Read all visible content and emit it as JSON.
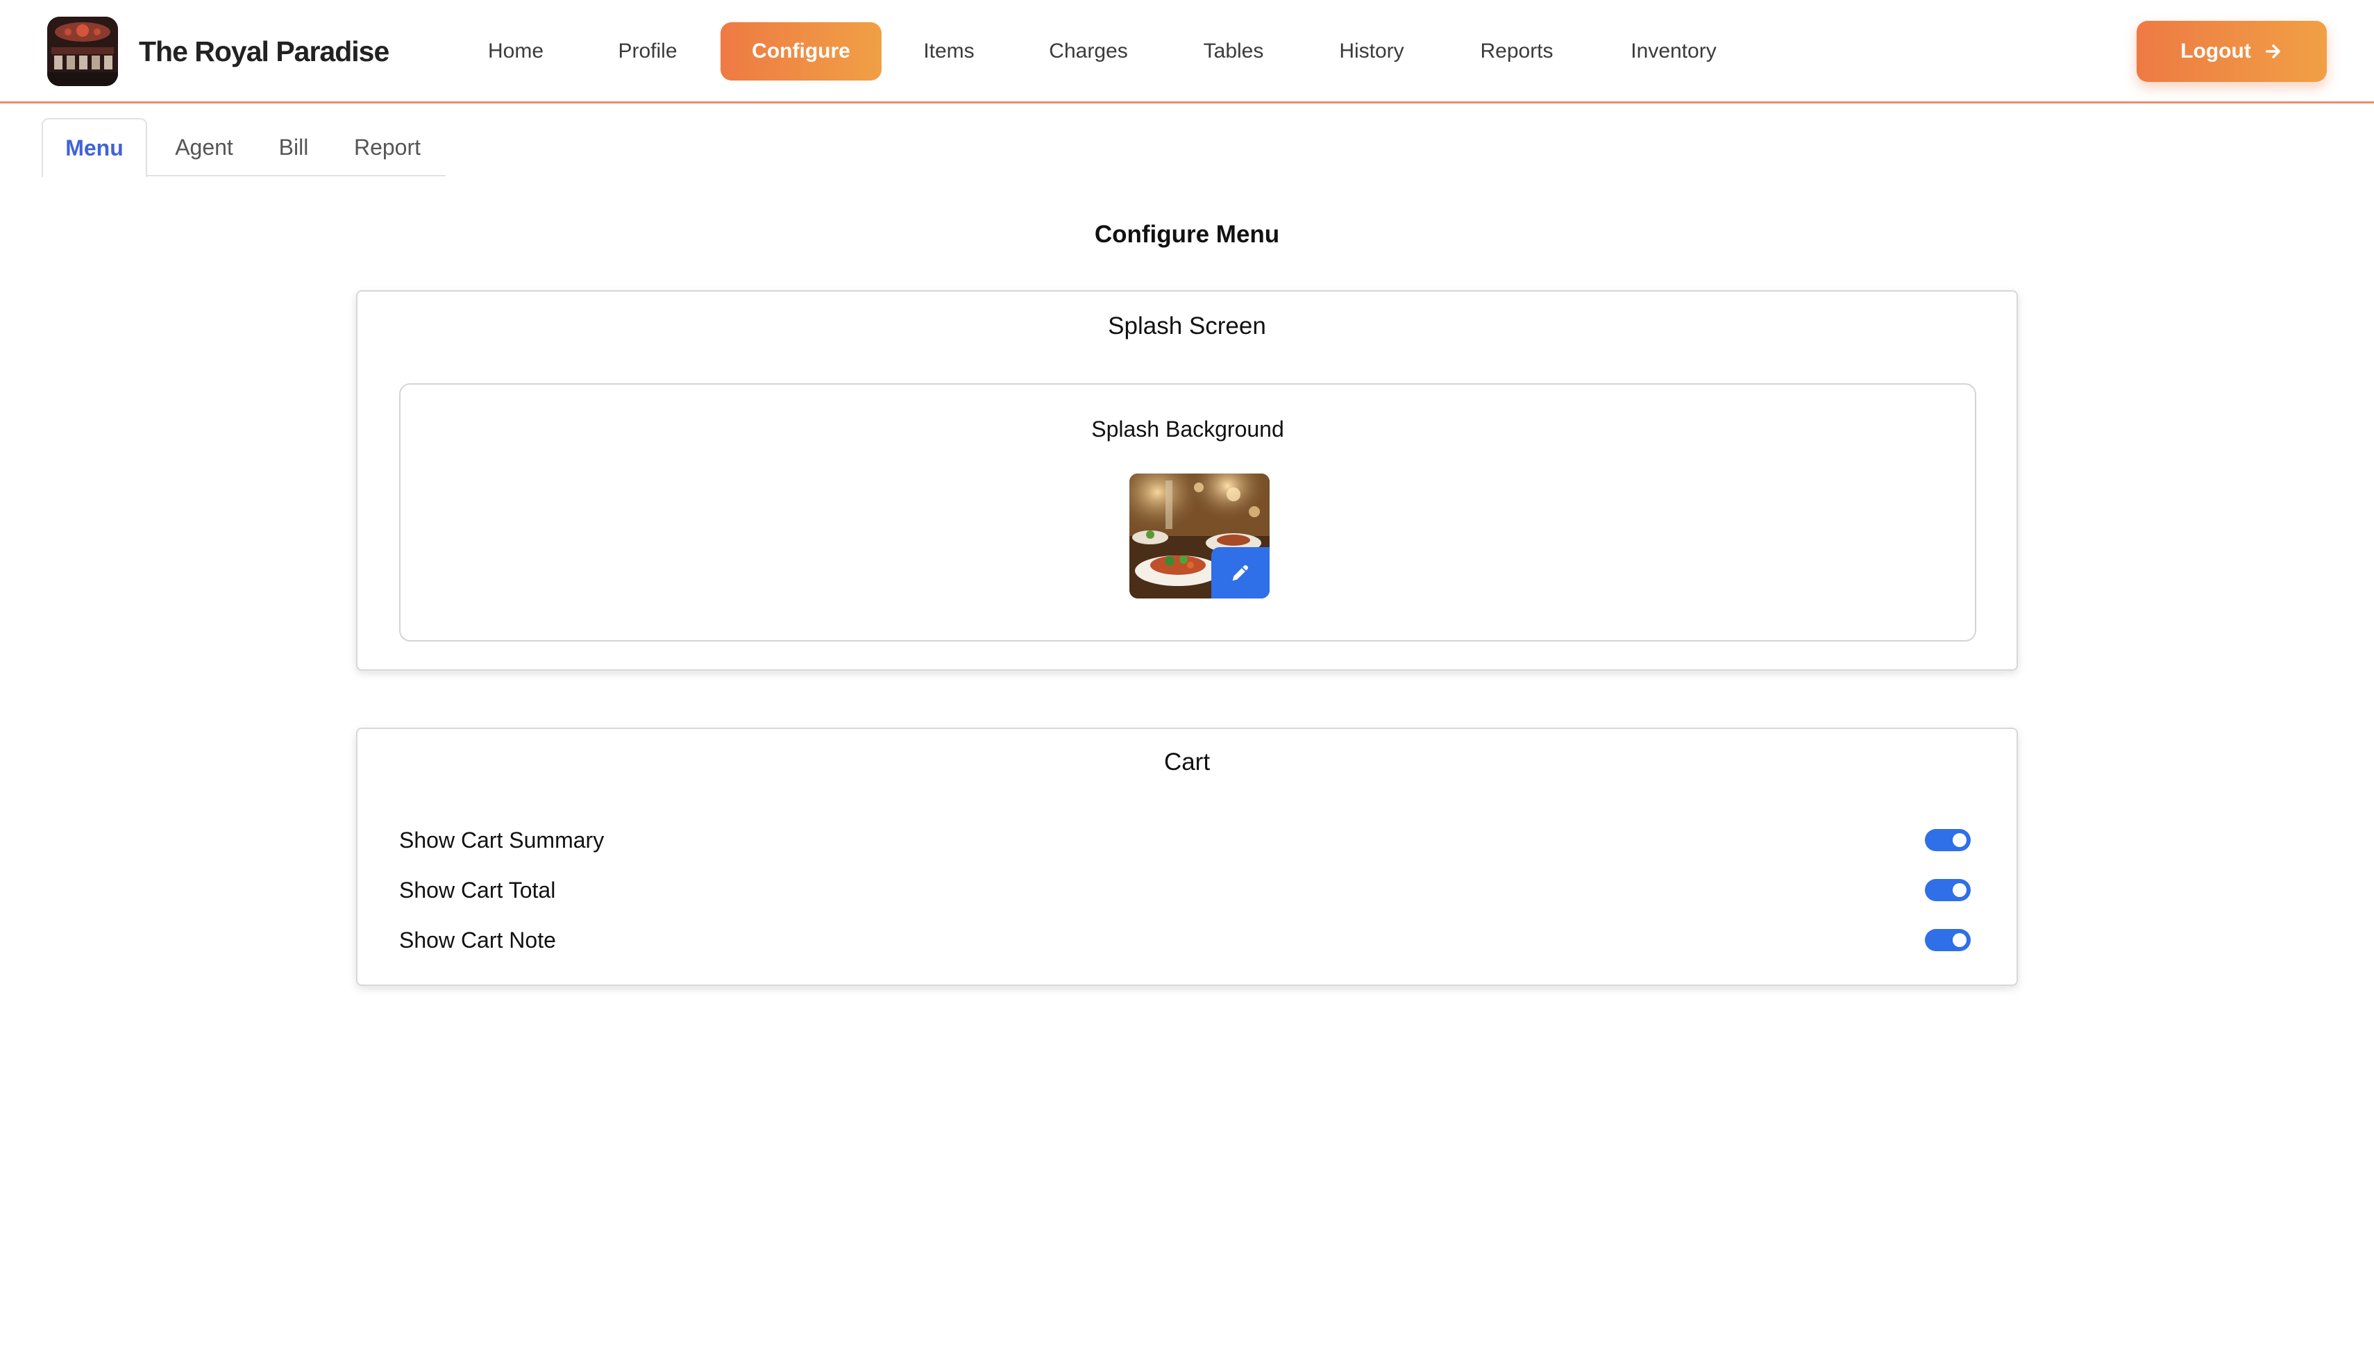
{
  "header": {
    "brand_name": "The Royal Paradise",
    "nav": [
      {
        "label": "Home",
        "active": false
      },
      {
        "label": "Profile",
        "active": false
      },
      {
        "label": "Configure",
        "active": true
      },
      {
        "label": "Items",
        "active": false
      },
      {
        "label": "Charges",
        "active": false
      },
      {
        "label": "Tables",
        "active": false
      },
      {
        "label": "History",
        "active": false
      },
      {
        "label": "Reports",
        "active": false
      },
      {
        "label": "Inventory",
        "active": false
      }
    ],
    "logout_label": "Logout",
    "accent_gradient": [
      "#ee7a44",
      "#f0a045"
    ]
  },
  "subtabs": [
    {
      "label": "Menu",
      "active": true
    },
    {
      "label": "Agent",
      "active": false
    },
    {
      "label": "Bill",
      "active": false
    },
    {
      "label": "Report",
      "active": false
    }
  ],
  "page_title": "Configure Menu",
  "splash": {
    "title": "Splash Screen",
    "background_title": "Splash Background",
    "edit_icon": "pencil-icon"
  },
  "cart": {
    "title": "Cart",
    "options": [
      {
        "label": "Show Cart Summary",
        "enabled": true
      },
      {
        "label": "Show Cart Total",
        "enabled": true
      },
      {
        "label": "Show Cart Note",
        "enabled": true
      }
    ],
    "toggle_color": "#2f6fe8"
  }
}
